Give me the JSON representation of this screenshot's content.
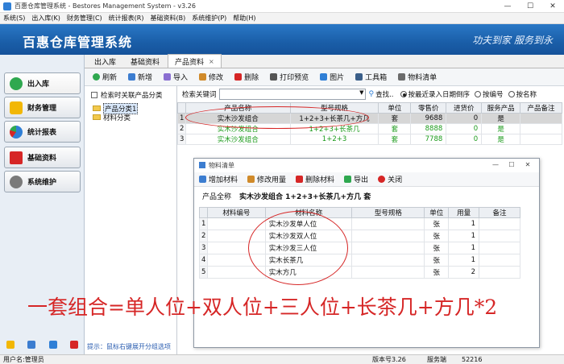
{
  "window": {
    "title": "百惠仓库管理系统 - Bestores Management System - v3.26",
    "controls": [
      "—",
      "☐",
      "✕"
    ]
  },
  "menu": [
    "系统(S)",
    "出入库(K)",
    "财务管理(C)",
    "统计报表(R)",
    "基础资料(B)",
    "系统维护(P)",
    "帮助(H)"
  ],
  "banner": {
    "brand": "百惠仓库管理系统",
    "slogan": "功夫到家  服务到永"
  },
  "leftnav": {
    "items": [
      {
        "label": "出入库",
        "icon": "check-icon",
        "color": "#2fa84f"
      },
      {
        "label": "财务管理",
        "icon": "star-icon",
        "color": "#f2b705"
      },
      {
        "label": "统计报表",
        "icon": "pie-chart-icon",
        "color": "#2f7fd6"
      },
      {
        "label": "基础资料",
        "icon": "book-icon",
        "color": "#d62626"
      },
      {
        "label": "系统维护",
        "icon": "gear-icon",
        "color": "#7a7a7a"
      }
    ]
  },
  "tabs": [
    {
      "label": "出入库"
    },
    {
      "label": "基础资料"
    },
    {
      "label": "产品资料",
      "close": "×"
    }
  ],
  "toolbar": {
    "items": [
      "刷新",
      "新增",
      "导入",
      "修改",
      "删除",
      "打印预览",
      "图片",
      "工具箱",
      "物料清单"
    ]
  },
  "category": {
    "checkbox_label": "检索时关联产品分类",
    "tree": [
      {
        "label": "产品分类1"
      },
      {
        "label": "材料分类"
      }
    ],
    "hint": "提示：鼠标右键展开分组选项"
  },
  "search": {
    "label": "检索关键词",
    "find_label": "查找..",
    "radios": [
      {
        "label": "按最近录入日期倒序",
        "checked": true
      },
      {
        "label": "按编号",
        "checked": false
      },
      {
        "label": "按名称",
        "checked": false
      }
    ]
  },
  "product_table": {
    "columns": [
      "产品名称",
      "型号规格",
      "单位",
      "零售价",
      "进货价",
      "服务产品",
      "产品备注"
    ],
    "rows": [
      {
        "idx": "1",
        "name": "实木沙发组合",
        "model": "1+2+3+长茶几+方几",
        "unit": "套",
        "retail": "9688",
        "cost": "0",
        "service": "是",
        "note": ""
      },
      {
        "idx": "2",
        "name": "实木沙发组合",
        "model": "1+2+3+长茶几",
        "unit": "套",
        "retail": "8888",
        "cost": "0",
        "service": "是",
        "note": ""
      },
      {
        "idx": "3",
        "name": "实木沙发组合",
        "model": "1+2+3",
        "unit": "套",
        "retail": "7788",
        "cost": "0",
        "service": "是",
        "note": ""
      }
    ]
  },
  "dialog": {
    "title": "物料清单",
    "controls": [
      "—",
      "☐",
      "✕"
    ],
    "toolbar": [
      "增加材料",
      "修改用量",
      "删除材料",
      "导出",
      "关闭"
    ],
    "product_label": "产品全称",
    "product_value": "实木沙发组合  1+2+3+长茶几+方几  套",
    "columns": [
      "材料编号",
      "材料名称",
      "型号规格",
      "单位",
      "用量",
      "备注"
    ],
    "rows": [
      {
        "idx": "1",
        "code": "",
        "name": "实木沙发单人位",
        "model": "",
        "unit": "张",
        "qty": "1",
        "note": ""
      },
      {
        "idx": "2",
        "code": "",
        "name": "实木沙发双人位",
        "model": "",
        "unit": "张",
        "qty": "1",
        "note": ""
      },
      {
        "idx": "3",
        "code": "",
        "name": "实木沙发三人位",
        "model": "",
        "unit": "张",
        "qty": "1",
        "note": ""
      },
      {
        "idx": "4",
        "code": "",
        "name": "实木长茶几",
        "model": "",
        "unit": "张",
        "qty": "1",
        "note": ""
      },
      {
        "idx": "5",
        "code": "",
        "name": "实木方几",
        "model": "",
        "unit": "张",
        "qty": "2",
        "note": ""
      }
    ]
  },
  "annotation": "一套组合=单人位+双人位+三人位+长茶几+方几*2",
  "statusbar": {
    "user": "用户名:管理员",
    "version": "版本号3.26",
    "server_label": "服务端",
    "server_value": "52216"
  }
}
